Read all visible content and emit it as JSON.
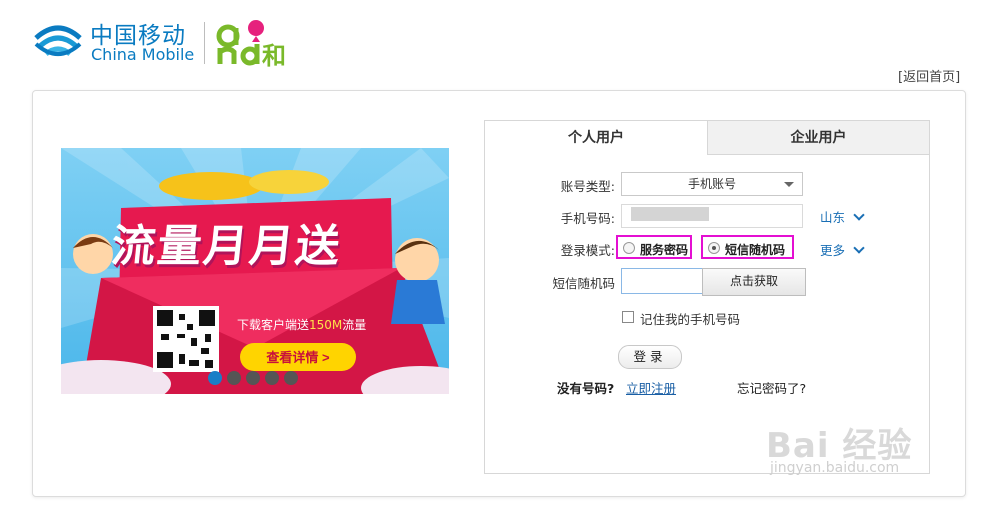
{
  "header": {
    "brand_cn": "中国移动",
    "brand_en": "China Mobile",
    "sub_brand": "和",
    "back_home": "[返回首页]"
  },
  "banner": {
    "title": "流量月月送",
    "subtitle_prefix": "下载客户端送",
    "subtitle_highlight": "150M",
    "subtitle_suffix": "流量",
    "button": "查看详情 >",
    "slides": 5,
    "active_slide": 1
  },
  "login": {
    "tabs": [
      {
        "label": "个人用户",
        "active": true
      },
      {
        "label": "企业用户",
        "active": false
      }
    ],
    "account_type_label": "账号类型:",
    "account_type_value": "手机账号",
    "phone_label": "手机号码:",
    "province": "山东",
    "mode_label": "登录模式:",
    "mode_options": [
      {
        "label": "服务密码",
        "checked": false
      },
      {
        "label": "短信随机码",
        "checked": true
      }
    ],
    "more": "更多",
    "sms_label": "短信随机码",
    "sms_button": "点击获取",
    "remember": "记住我的手机号码",
    "submit": "登录",
    "no_account": "没有号码?",
    "register": "立即注册",
    "forgot": "忘记密码了?"
  },
  "watermark": {
    "text": "Bai 经验",
    "sub": "jingyan.baidu.com"
  },
  "colors": {
    "brand_blue": "#0a7bc1",
    "sub_brand_green": "#7ab92a",
    "sub_brand_pink": "#e6217d",
    "highlight_magenta": "#e40fd2",
    "link_blue": "#1a6fb5"
  }
}
